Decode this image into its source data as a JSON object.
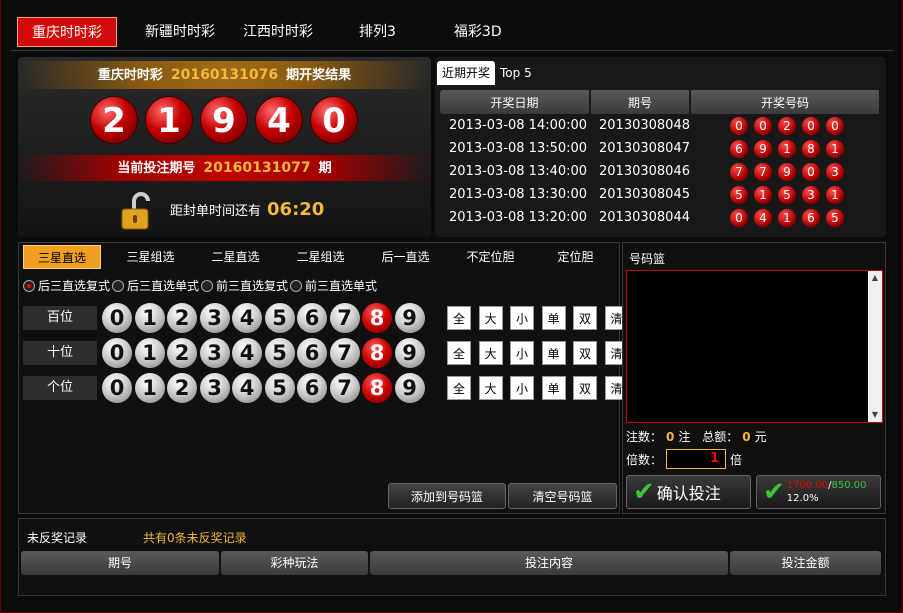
{
  "topnav": [
    "重庆时时彩",
    "新疆时时彩",
    "江西时时彩",
    "排列3",
    "福彩3D"
  ],
  "result": {
    "lottery_name": "重庆时时彩",
    "issue": "20160131076",
    "suffix": "期开奖结果",
    "numbers": [
      "2",
      "1",
      "9",
      "4",
      "0"
    ],
    "current_label": "当前投注期号",
    "current_issue": "20160131077",
    "current_suffix": "期",
    "countdown_label": "距封单时间还有",
    "countdown": "06:20"
  },
  "recent": {
    "tabs": [
      "近期开奖",
      "Top 5"
    ],
    "headers": [
      "开奖日期",
      "期号",
      "开奖号码"
    ],
    "rows": [
      {
        "date": "2013-03-08 14:00:00",
        "issue": "20130308048",
        "nums": [
          "0",
          "0",
          "2",
          "0",
          "0"
        ]
      },
      {
        "date": "2013-03-08 13:50:00",
        "issue": "20130308047",
        "nums": [
          "6",
          "9",
          "1",
          "8",
          "1"
        ]
      },
      {
        "date": "2013-03-08 13:40:00",
        "issue": "20130308046",
        "nums": [
          "7",
          "7",
          "9",
          "0",
          "3"
        ]
      },
      {
        "date": "2013-03-08 13:30:00",
        "issue": "20130308045",
        "nums": [
          "5",
          "1",
          "5",
          "3",
          "1"
        ]
      },
      {
        "date": "2013-03-08 13:20:00",
        "issue": "20130308044",
        "nums": [
          "0",
          "4",
          "1",
          "6",
          "5"
        ]
      }
    ]
  },
  "play_tabs": [
    "三星直选",
    "三星组选",
    "二星直选",
    "二星组选",
    "后一直选",
    "不定位胆",
    "定位胆"
  ],
  "radios": [
    "后三直选复式",
    "后三直选单式",
    "前三直选复式",
    "前三直选单式"
  ],
  "positions": [
    "百位",
    "十位",
    "个位"
  ],
  "digits": [
    "0",
    "1",
    "2",
    "3",
    "4",
    "5",
    "6",
    "7",
    "8",
    "9"
  ],
  "selected_digit": "8",
  "quick_buttons": [
    "全",
    "大",
    "小",
    "单",
    "双",
    "清"
  ],
  "actions": {
    "add": "添加到号码篮",
    "clear": "清空号码篮"
  },
  "basket": {
    "title": "号码篮",
    "bets_label": "注数：",
    "bets_value": "0",
    "bets_unit": "注",
    "total_label": "总额：",
    "total_value": "0",
    "total_unit": "元",
    "mult_label": "倍数：",
    "mult_value": "1",
    "mult_unit": "倍",
    "confirm": "确认投注",
    "balance_a": "1700.00",
    "balance_sep": "/",
    "balance_b": "850.00",
    "percent": "12.0%"
  },
  "records": {
    "title": "未反奖记录",
    "summary": "共有0条未反奖记录",
    "headers": [
      "期号",
      "彩种玩法",
      "投注内容",
      "投注金额"
    ]
  },
  "colors": {
    "accent": "#d20a0a",
    "gold": "#f2b93a",
    "green": "#3ec23e"
  }
}
